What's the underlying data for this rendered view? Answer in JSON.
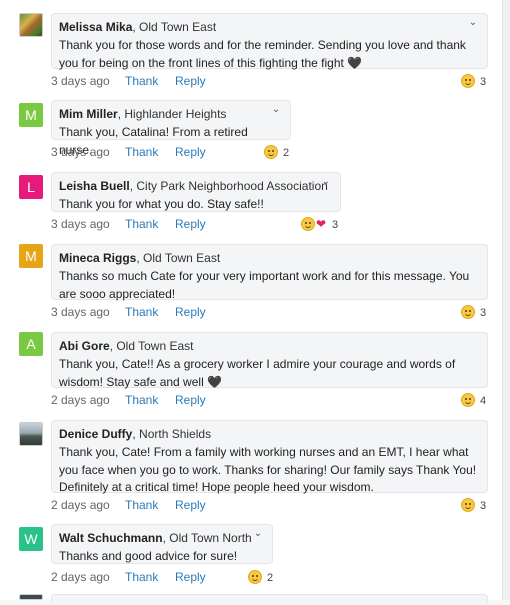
{
  "comments": [
    {
      "author": "Melissa Mika",
      "hood": ", Old Town East",
      "avatar": "",
      "avatar_type": "photo-flowers",
      "text": "Thank you for those words and for the reminder. Sending you love and thank you for being on the front lines of this fighting the fight 🖤",
      "date": "3 days ago",
      "thank": "Thank",
      "reply": "Reply",
      "reactions": [
        "smile"
      ],
      "count": "3"
    },
    {
      "author": "Mim Miller",
      "hood": ", Highlander Heights",
      "avatar": "M",
      "avatar_color": "#7ac943",
      "text": "Thank you, Catalina!  From a retired nurse.",
      "date": "3 days ago",
      "thank": "Thank",
      "reply": "Reply",
      "reactions": [
        "smile"
      ],
      "count": "2"
    },
    {
      "author": "Leisha Buell",
      "hood": ", City Park Neighborhood Association",
      "avatar": "L",
      "avatar_color": "#e6197c",
      "text": "Thank you for what you do. Stay safe!!",
      "date": "3 days ago",
      "thank": "Thank",
      "reply": "Reply",
      "reactions": [
        "smile",
        "heart"
      ],
      "count": "3"
    },
    {
      "author": "Mineca Riggs",
      "hood": ", Old Town East",
      "avatar": "M",
      "avatar_color": "#e6a417",
      "text": "Thanks so much Cate for your very important work and for this message. You are sooo appreciated!",
      "date": "3 days ago",
      "thank": "Thank",
      "reply": "Reply",
      "reactions": [
        "smile"
      ],
      "count": "3"
    },
    {
      "author": "Abi Gore",
      "hood": ", Old Town East",
      "avatar": "A",
      "avatar_color": "#7ac943",
      "text": "Thank you, Cate!! As a grocery worker I admire your courage and words of wisdom! Stay safe and well 🖤",
      "date": "2 days ago",
      "thank": "Thank",
      "reply": "Reply",
      "reactions": [
        "smile"
      ],
      "count": "4"
    },
    {
      "author": "Denice Duffy",
      "hood": ", North Shields",
      "avatar": "",
      "avatar_type": "photo-land",
      "text": "Thank you, Cate! From a family with working nurses and an EMT, I hear what you face when you go to work. Thanks for sharing! Our family says Thank You! Definitely at a critical time! Hope people heed your wisdom.",
      "date": "2 days ago",
      "thank": "Thank",
      "reply": "Reply",
      "reactions": [
        "smile"
      ],
      "count": "3"
    },
    {
      "author": "Walt Schuchmann",
      "hood": ", Old Town North",
      "avatar": "W",
      "avatar_color": "#29c38a",
      "text": "Thanks and good advice for sure!",
      "date": "2 days ago",
      "thank": "Thank",
      "reply": "Reply",
      "reactions": [
        "smile"
      ],
      "count": "2"
    }
  ],
  "colors": {
    "link": "#2b7ab8",
    "bubble": "#f4f5f7"
  }
}
